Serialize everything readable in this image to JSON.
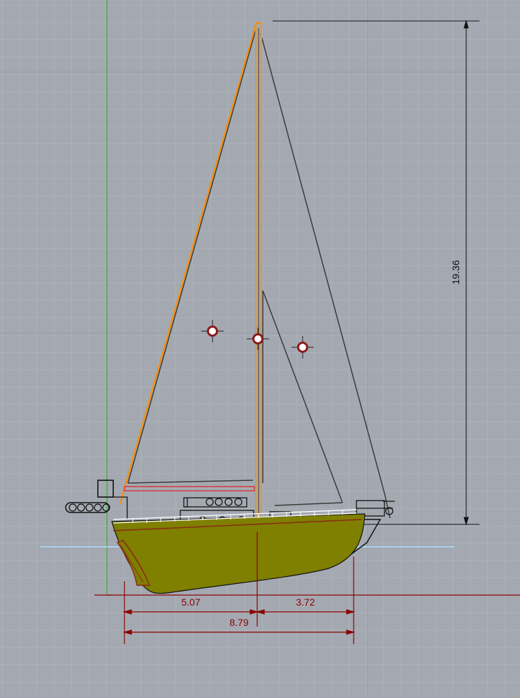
{
  "viewport": {
    "view": "Front",
    "background_color": "#a4a9b1",
    "grid_color": "#b3b8bf",
    "grid_major_color": "#9aa0a8"
  },
  "colors": {
    "hull": "#7f7f00",
    "hull_stripe": "#8b2a16",
    "rig_selected": "#f0901e",
    "rig_lines": "#3a3a3a",
    "dimension": "#8b0000",
    "dimension_vertical": "#111111",
    "waterline": "#a9d2ee",
    "y_axis": "#2eaa2e",
    "x_axis": "#8b0000"
  },
  "dimensions": {
    "mast_height": "19.36",
    "bow_to_mast": "5.07",
    "mast_to_stern": "3.72",
    "overall_length": "8.79"
  },
  "icons": {
    "centroid_marker": "centroid-target-icon"
  }
}
